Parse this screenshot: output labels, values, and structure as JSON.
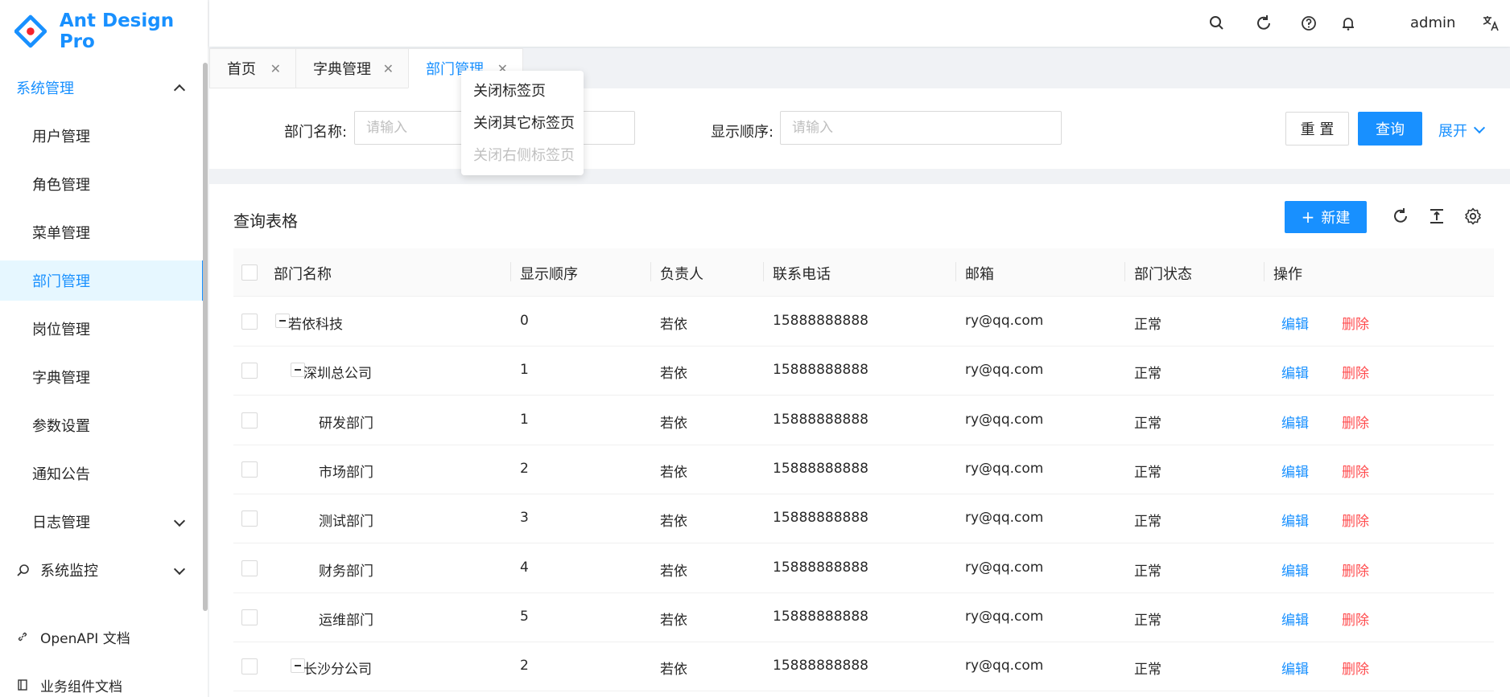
{
  "app": {
    "title": "Ant Design Pro"
  },
  "sidebar": {
    "groups": [
      {
        "label": "系统管理"
      },
      {
        "label": "系统监控"
      }
    ],
    "items": [
      {
        "label": "用户管理"
      },
      {
        "label": "角色管理"
      },
      {
        "label": "菜单管理"
      },
      {
        "label": "部门管理"
      },
      {
        "label": "岗位管理"
      },
      {
        "label": "字典管理"
      },
      {
        "label": "参数设置"
      },
      {
        "label": "通知公告"
      },
      {
        "label": "日志管理"
      }
    ],
    "footer": [
      {
        "label": "OpenAPI 文档"
      },
      {
        "label": "业务组件文档"
      }
    ]
  },
  "header": {
    "user": "admin",
    "icons": [
      "search-icon",
      "reload-icon",
      "question-icon",
      "bell-icon",
      "translate-icon"
    ]
  },
  "tabs": [
    {
      "label": "首页",
      "active": false
    },
    {
      "label": "字典管理",
      "active": false
    },
    {
      "label": "部门管理",
      "active": true
    }
  ],
  "context_menu": [
    {
      "label": "关闭标签页",
      "disabled": false
    },
    {
      "label": "关闭其它标签页",
      "disabled": false
    },
    {
      "label": "关闭右侧标签页",
      "disabled": true
    }
  ],
  "search": {
    "dept_name_label": "部门名称:",
    "dept_name_placeholder": "请输入",
    "order_label": "显示顺序:",
    "order_placeholder": "请输入",
    "reset_label": "重 置",
    "query_label": "查询",
    "expand_label": "展开"
  },
  "table": {
    "title": "查询表格",
    "new_label": "新建",
    "columns": [
      "部门名称",
      "显示顺序",
      "负责人",
      "联系电话",
      "邮箱",
      "部门状态",
      "操作"
    ],
    "edit_label": "编辑",
    "delete_label": "删除",
    "rows": [
      {
        "name": "若依科技",
        "order": "0",
        "leader": "若依",
        "phone": "15888888888",
        "email": "ry@qq.com",
        "status": "正常",
        "level": 0,
        "expandable": true
      },
      {
        "name": "深圳总公司",
        "order": "1",
        "leader": "若依",
        "phone": "15888888888",
        "email": "ry@qq.com",
        "status": "正常",
        "level": 1,
        "expandable": true
      },
      {
        "name": "研发部门",
        "order": "1",
        "leader": "若依",
        "phone": "15888888888",
        "email": "ry@qq.com",
        "status": "正常",
        "level": 2,
        "expandable": false
      },
      {
        "name": "市场部门",
        "order": "2",
        "leader": "若依",
        "phone": "15888888888",
        "email": "ry@qq.com",
        "status": "正常",
        "level": 2,
        "expandable": false
      },
      {
        "name": "测试部门",
        "order": "3",
        "leader": "若依",
        "phone": "15888888888",
        "email": "ry@qq.com",
        "status": "正常",
        "level": 2,
        "expandable": false
      },
      {
        "name": "财务部门",
        "order": "4",
        "leader": "若依",
        "phone": "15888888888",
        "email": "ry@qq.com",
        "status": "正常",
        "level": 2,
        "expandable": false
      },
      {
        "name": "运维部门",
        "order": "5",
        "leader": "若依",
        "phone": "15888888888",
        "email": "ry@qq.com",
        "status": "正常",
        "level": 2,
        "expandable": false
      },
      {
        "name": "长沙分公司",
        "order": "2",
        "leader": "若依",
        "phone": "15888888888",
        "email": "ry@qq.com",
        "status": "正常",
        "level": 1,
        "expandable": true
      }
    ]
  },
  "colors": {
    "primary": "#1890ff",
    "danger": "#ff4d4f"
  }
}
